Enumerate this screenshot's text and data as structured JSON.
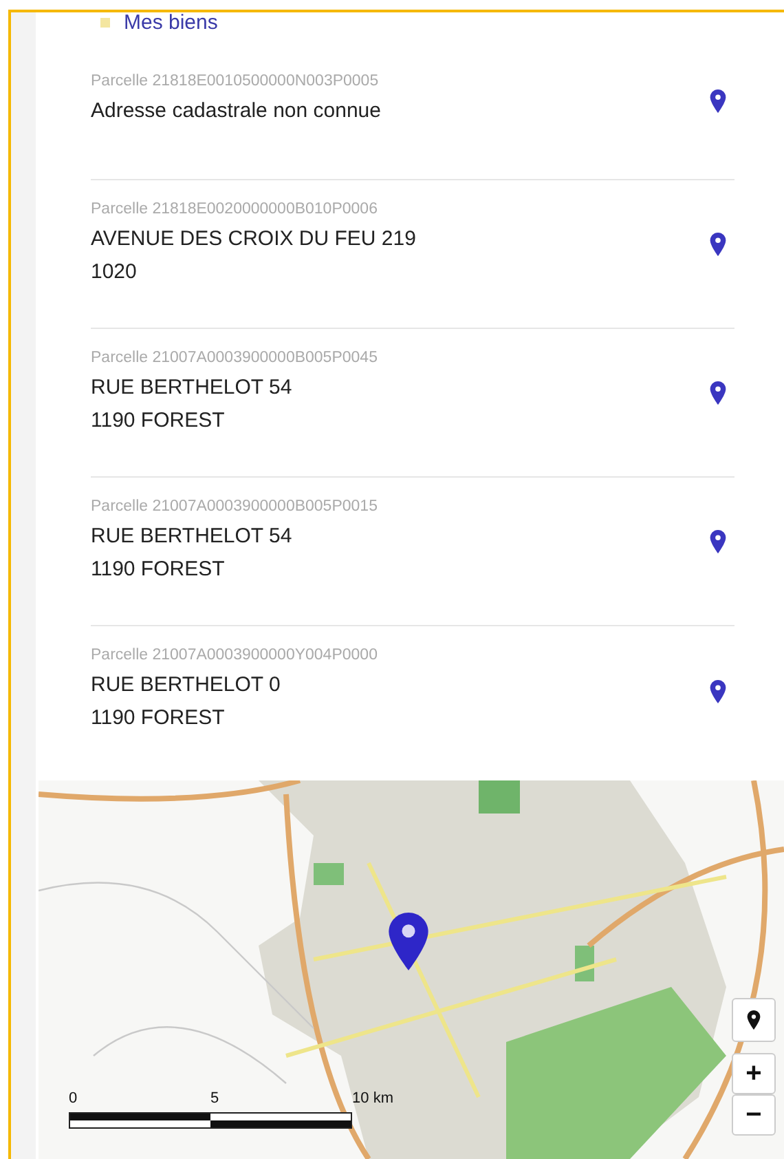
{
  "header": {
    "title": "Mes biens"
  },
  "parcels": [
    {
      "parcel": "Parcelle 21818E0010500000N003P0005",
      "lines": [
        "Adresse cadastrale non connue"
      ]
    },
    {
      "parcel": "Parcelle 21818E0020000000B010P0006",
      "lines": [
        "AVENUE DES CROIX DU FEU 219",
        "1020"
      ]
    },
    {
      "parcel": "Parcelle 21007A0003900000B005P0045",
      "lines": [
        "RUE BERTHELOT 54",
        "1190 FOREST"
      ]
    },
    {
      "parcel": "Parcelle 21007A0003900000B005P0015",
      "lines": [
        "RUE BERTHELOT 54",
        "1190 FOREST"
      ]
    },
    {
      "parcel": "Parcelle 21007A0003900000Y004P0000",
      "lines": [
        "RUE BERTHELOT 0",
        "1190 FOREST"
      ]
    }
  ],
  "map": {
    "scale": [
      "0",
      "5",
      "10 km"
    ],
    "zoom_in": "+",
    "zoom_out": "−"
  }
}
